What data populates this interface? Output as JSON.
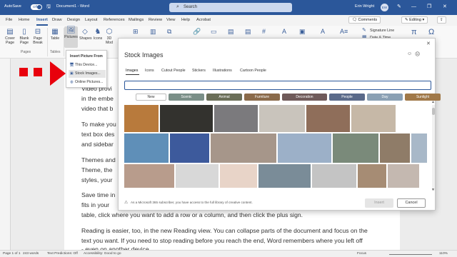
{
  "titlebar": {
    "autosave_label": "AutoSave",
    "autosave_state": "Off",
    "doc_title": "Document1 - Word",
    "search_placeholder": "Search",
    "user_name": "Erin Wright",
    "user_initials": "EW",
    "minimize": "—",
    "restore": "❐",
    "close": "✕"
  },
  "menubar": {
    "tabs": [
      "File",
      "Home",
      "Insert",
      "Draw",
      "Design",
      "Layout",
      "References",
      "Mailings",
      "Review",
      "View",
      "Help",
      "Acrobat"
    ],
    "active_tab": "Insert",
    "comments_label": "Comments",
    "editing_label": "Editing",
    "share_icon": "share-icon"
  },
  "ribbon": {
    "pages": {
      "cover": "Cover Page",
      "blank": "Blank Page",
      "break": "Page Break",
      "group": "Pages"
    },
    "tables": {
      "table": "Table",
      "group": "Tables"
    },
    "illustrations": {
      "pictures": "Pictures",
      "shapes": "Shapes",
      "icons": "Icons",
      "models": "3D Mod"
    },
    "text": {
      "signature_line": "Signature Line",
      "date_time": "Date & Time"
    }
  },
  "picture_menu": {
    "header": "Insert Picture From",
    "items": [
      "This Device...",
      "Stock Images...",
      "Online Pictures..."
    ],
    "highlighted_index": 1
  },
  "document": {
    "lines": [
      "Video provi",
      "in the embe",
      "video that b",
      "To make you",
      "text box des",
      "and sidebar",
      "Themes and",
      "Theme, the",
      "styles, your",
      "Save time in",
      "fits in your",
      "table, click where you want to add a row or a column, and then click the plus sign.",
      "Reading is easier, too, in the new Reading view. You can collapse parts of the document and focus on the",
      "text you want. If you need to stop reading before you reach the end, Word remembers where you left off",
      "- even on another device."
    ]
  },
  "stock_dialog": {
    "title": "Stock Images",
    "tabs": [
      "Images",
      "Icons",
      "Cutout People",
      "Stickers",
      "Illustrations",
      "Cartoon People"
    ],
    "active_tab": "Images",
    "search_value": "",
    "chips": [
      "New",
      "Scenic",
      "Animal",
      "Furniture",
      "Decoration",
      "People",
      "Day",
      "Sunlight"
    ],
    "selected_chip": "New",
    "footer_text": "As a Microsoft 365 subscriber, you have access to the full library of creative content.",
    "insert_label": "Insert",
    "cancel_label": "Cancel",
    "chip_colors": [
      "#ffffff",
      "#7a8f88",
      "#6a6e58",
      "#8a6a4a",
      "#6f5a5a",
      "#5a6a8a",
      "#8aa0b4",
      "#a07848"
    ],
    "thumb_colors": [
      "#b87a3c",
      "#33322e",
      "#7b7a7d",
      "#c9c4bc",
      "#8f6e5a",
      "#c6b8a7",
      "#5f8fb8",
      "#3d5a9c",
      "#a6968a",
      "#9cb0c8",
      "#7a8a7a",
      "#8f7c68",
      "#a8b8c8",
      "#b89c8c",
      "#d8d8d8",
      "#e8d4c8",
      "#7a8c98",
      "#c4c4c4",
      "#a68c74",
      "#c4b8b0",
      "#7aa6c4",
      "#4a5a4a",
      "#98a8b4",
      "#b8b4ac",
      "#a8c0c8",
      "#c8a8a0",
      "#8c7c6c"
    ]
  },
  "statusbar": {
    "page": "Page 1 of 1",
    "words": "243 words",
    "predictions": "Text Predictions: Off",
    "accessibility": "Accessibility: Good to go",
    "focus": "Focus",
    "zoom": "110%"
  },
  "colors": {
    "accent": "#2b579a",
    "callout_red": "#e8000c"
  }
}
